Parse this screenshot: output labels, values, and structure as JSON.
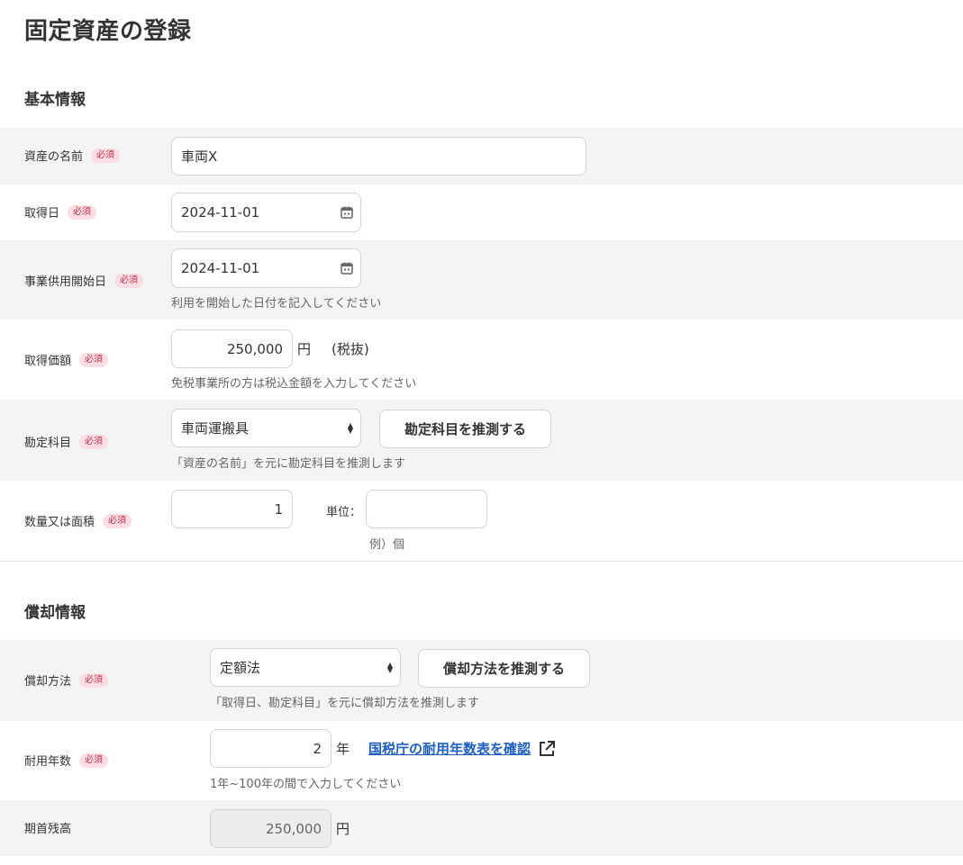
{
  "page_title": "固定資産の登録",
  "basic": {
    "section_title": "基本情報",
    "required_label": "必須",
    "asset_name": {
      "label": "資産の名前",
      "value": "車両X"
    },
    "acquisition_date": {
      "label": "取得日",
      "value": "2024-11-01"
    },
    "service_start_date": {
      "label": "事業供用開始日",
      "value": "2024-11-01",
      "hint": "利用を開始した日付を記入してください"
    },
    "acquisition_price": {
      "label": "取得価額",
      "value": "250,000",
      "unit": "円",
      "tax_note": "(税抜)",
      "hint": "免税事業所の方は税込金額を入力してください"
    },
    "account": {
      "label": "勘定科目",
      "value": "車両運搬具",
      "button": "勘定科目を推測する",
      "hint": "「資産の名前」を元に勘定科目を推測します"
    },
    "quantity": {
      "label": "数量又は面積",
      "value": "1",
      "unit_label": "単位：",
      "unit_value": "",
      "unit_hint": "例）個"
    }
  },
  "depreciation": {
    "section_title": "償却情報",
    "method": {
      "label": "償却方法",
      "value": "定額法",
      "button": "償却方法を推測する",
      "hint": "「取得日、勘定科目」を元に償却方法を推測します"
    },
    "useful_life": {
      "label": "耐用年数",
      "value": "2",
      "unit": "年",
      "link": "国税庁の耐用年数表を確認",
      "hint": "1年~100年の間で入力してください"
    },
    "opening_balance": {
      "label": "期首残高",
      "value": "250,000",
      "unit": "円"
    }
  },
  "icons": {
    "calendar": "calendar-icon",
    "select": "select-arrows-icon",
    "external": "external-link-icon"
  },
  "colors": {
    "required_bg": "#fbdde3",
    "required_text": "#c0304a",
    "link": "#1e5fbf",
    "shaded_row": "#f5f4f4"
  }
}
